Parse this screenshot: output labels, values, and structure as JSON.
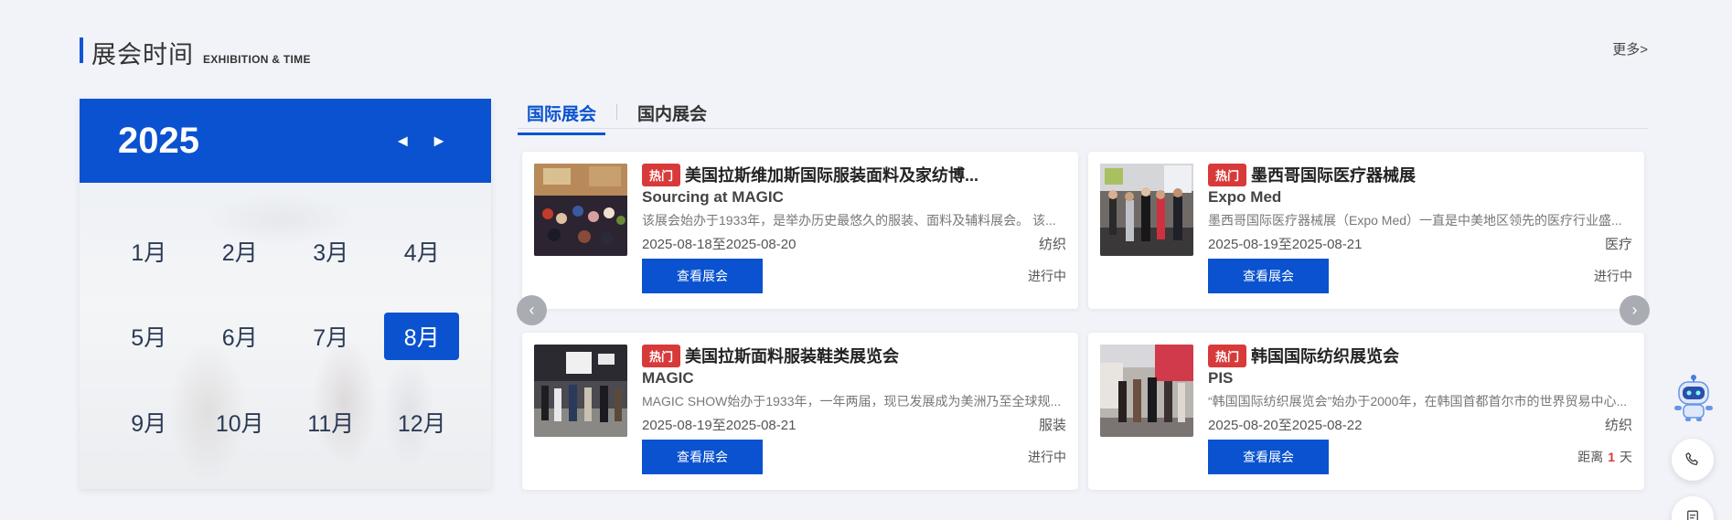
{
  "header": {
    "title_cn": "展会时间",
    "title_en": "EXHIBITION & TIME",
    "more": "更多>"
  },
  "calendar": {
    "year": "2025",
    "prev_icon": "◄",
    "next_icon": "►",
    "months": [
      "1月",
      "2月",
      "3月",
      "4月",
      "5月",
      "6月",
      "7月",
      "8月",
      "9月",
      "10月",
      "11月",
      "12月"
    ],
    "selected": "8月"
  },
  "tabs": [
    {
      "label": "国际展会",
      "active": true
    },
    {
      "label": "国内展会",
      "active": false
    }
  ],
  "cards": [
    {
      "badge": "热门",
      "name_cn": "美国拉斯维加斯国际服装面料及家纺博...",
      "name_en": "Sourcing at MAGIC",
      "desc": "该展会始办于1933年，是举办历史最悠久的服装、面料及辅料展会。 该...",
      "date": "2025-08-18至2025-08-20",
      "category": "纺织",
      "button": "查看展会",
      "status": "进行中"
    },
    {
      "badge": "热门",
      "name_cn": "墨西哥国际医疗器械展",
      "name_en": "Expo Med",
      "desc": "墨西哥国际医疗器械展（Expo Med）一直是中美地区领先的医疗行业盛...",
      "date": "2025-08-19至2025-08-21",
      "category": "医疗",
      "button": "查看展会",
      "status": "进行中"
    },
    {
      "badge": "热门",
      "name_cn": "美国拉斯面料服装鞋类展览会",
      "name_en": "MAGIC",
      "desc": "MAGIC SHOW始办于1933年，一年两届，现已发展成为美洲乃至全球规...",
      "date": "2025-08-19至2025-08-21",
      "category": "服装",
      "button": "查看展会",
      "status": "进行中"
    },
    {
      "badge": "热门",
      "name_cn": "韩国国际纺织展览会",
      "name_en": "PIS",
      "desc": "“韩国国际纺织展览会”始办于2000年，在韩国首都首尔市的世界贸易中心...",
      "date": "2025-08-20至2025-08-22",
      "category": "纺织",
      "button": "查看展会",
      "status_prefix": "距离",
      "status_num": "1",
      "status_suffix": "天"
    }
  ],
  "carousel": {
    "prev_icon": "‹",
    "next_icon": "›"
  },
  "side": {
    "robot_icon": "robot-icon",
    "phone_icon": "phone-icon",
    "doc_icon": "document-icon"
  }
}
